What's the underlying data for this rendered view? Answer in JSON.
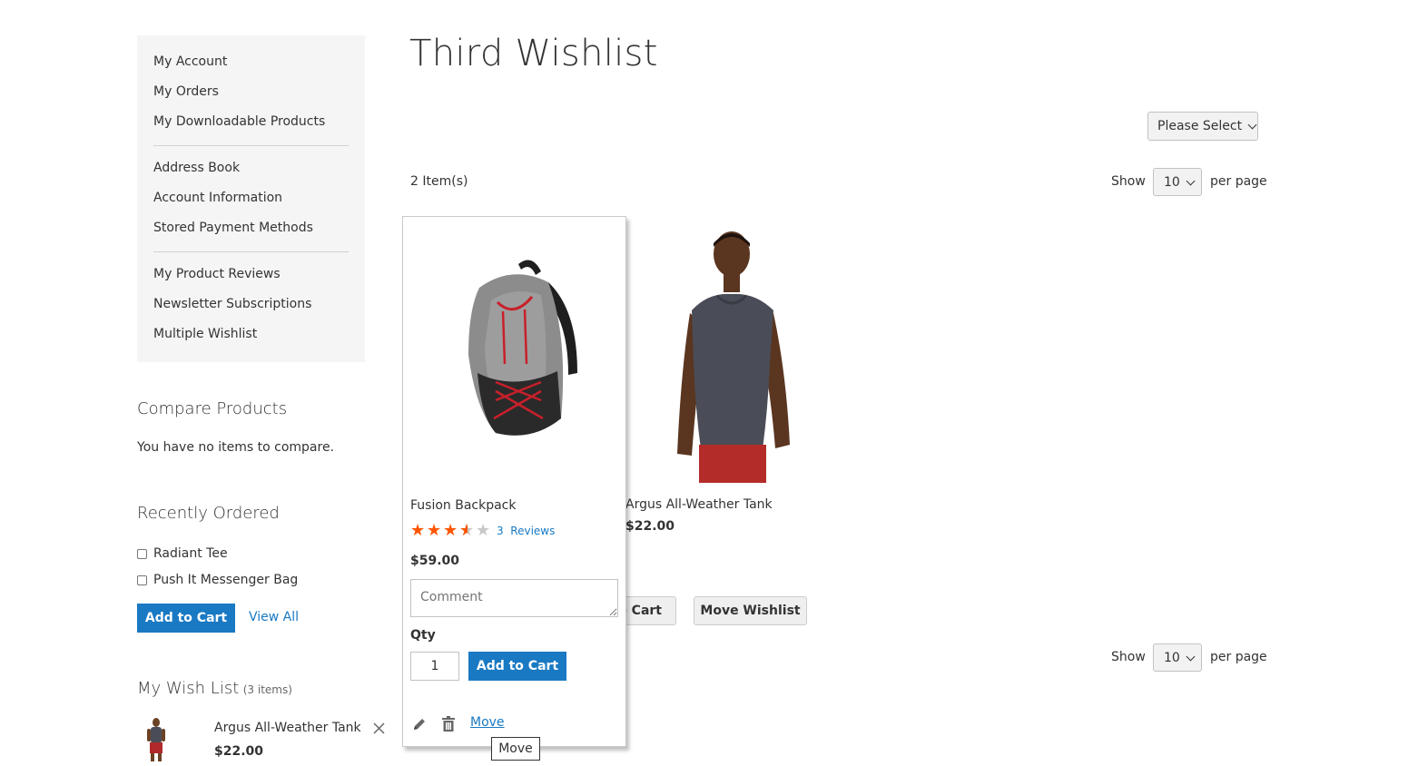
{
  "sidebar": {
    "nav_group_1": [
      "My Account",
      "My Orders",
      "My Downloadable Products"
    ],
    "nav_group_2": [
      "Address Book",
      "Account Information",
      "Stored Payment Methods"
    ],
    "nav_group_3": [
      "My Product Reviews",
      "Newsletter Subscriptions",
      "Multiple Wishlist"
    ],
    "compare": {
      "title": "Compare Products",
      "empty_text": "You have no items to compare."
    },
    "recently_ordered": {
      "title": "Recently Ordered",
      "items": [
        "Radiant Tee",
        "Push It Messenger Bag"
      ],
      "add_to_cart_label": "Add to Cart",
      "view_all_label": "View All"
    },
    "wishlist": {
      "title": "My Wish List",
      "count": "(3 items)",
      "item_name": "Argus All-Weather Tank",
      "item_price": "$22.00"
    }
  },
  "main": {
    "title": "Third Wishlist",
    "wishlist_select": "Please Select",
    "item_count": "2 Item(s)",
    "toolbar_top": {
      "show_label": "Show",
      "limit": "10",
      "per_page_label": "per page"
    },
    "toolbar_bottom": {
      "show_label": "Show",
      "limit": "10",
      "per_page_label": "per page"
    },
    "products": [
      {
        "name": "Fusion Backpack",
        "rating_percent": 67,
        "reviews_count": "3",
        "reviews_label": "Reviews",
        "price": "$59.00",
        "comment_placeholder": "Comment",
        "qty_label": "Qty",
        "qty_value": "1",
        "add_to_cart_label": "Add to Cart",
        "move_label": "Move"
      },
      {
        "name": "Argus All-Weather Tank",
        "price": "$22.00"
      }
    ],
    "actions": {
      "add_all_to_cart_label": "Add All to Cart",
      "move_wishlist_label": "Move Wishlist"
    },
    "tooltip": "Move"
  },
  "colors": {
    "accent": "#1979c3",
    "star": "#ff5501",
    "sidebar_bg": "#f5f5f5"
  }
}
